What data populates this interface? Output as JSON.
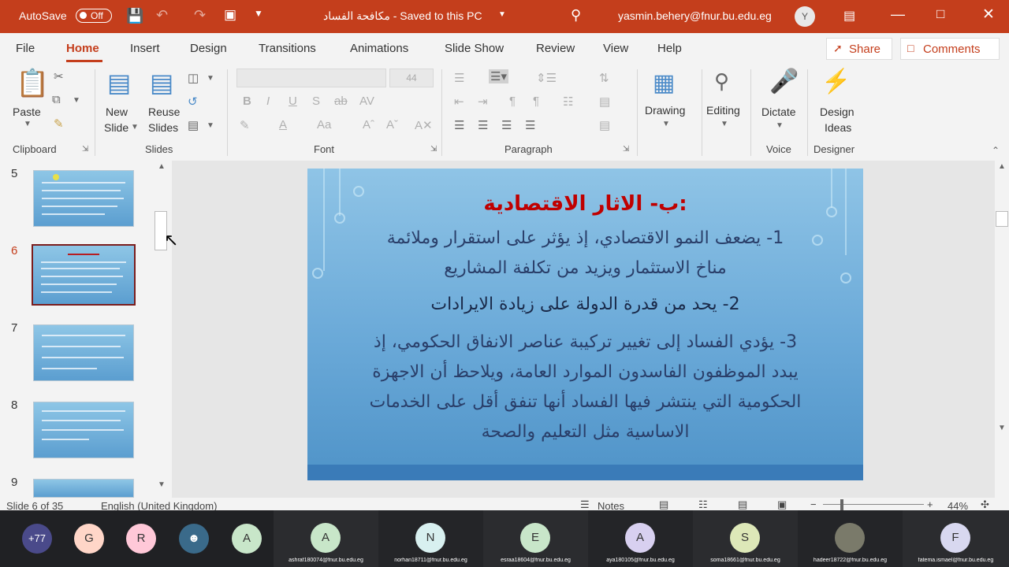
{
  "titlebar": {
    "autosave_label": "AutoSave",
    "autosave_state": "Off",
    "doc_title": "مكافحة الفساد  -  Saved to this PC",
    "user_email": "yasmin.behery@fnur.bu.edu.eg",
    "user_initial": "Y"
  },
  "menu": {
    "items": [
      "File",
      "Home",
      "Insert",
      "Design",
      "Transitions",
      "Animations",
      "Slide Show",
      "Review",
      "View",
      "Help"
    ],
    "share": "Share",
    "comments": "Comments"
  },
  "ribbon": {
    "clipboard": {
      "paste": "Paste",
      "group": "Clipboard"
    },
    "slides": {
      "new_slide_1": "New",
      "new_slide_2": "Slide",
      "reuse_1": "Reuse",
      "reuse_2": "Slides",
      "group": "Slides"
    },
    "font": {
      "group": "Font",
      "size_placeholder": "44"
    },
    "paragraph": {
      "group": "Paragraph"
    },
    "drawing": {
      "label": "Drawing"
    },
    "editing": {
      "label": "Editing"
    },
    "voice": {
      "dictate": "Dictate",
      "group": "Voice"
    },
    "designer": {
      "ideas_1": "Design",
      "ideas_2": "Ideas",
      "group": "Designer"
    }
  },
  "thumbnails": [
    {
      "num": "5"
    },
    {
      "num": "6",
      "selected": true
    },
    {
      "num": "7"
    },
    {
      "num": "8"
    },
    {
      "num": "9"
    }
  ],
  "slide": {
    "title": "ب- الاثار الاقتصادية:",
    "line1": "1- يضعف النمو الاقتصادي، إذ يؤثر على استقرار وملائمة",
    "line2": "مناخ الاستثمار ويزيد من تكلفة المشاريع",
    "line3": "2- يحد من قدرة الدولة على زيادة الايرادات",
    "line4": "3- يؤدي الفساد إلى تغيير تركيبة عناصر الانفاق الحكومي، إذ",
    "line5": "يبدد الموظفون الفاسدون الموارد العامة، ويلاحظ أن الاجهزة",
    "line6": "الحكومية التي ينتشر فيها الفساد أنها تنفق أقل على الخدمات",
    "line7": "الاساسية مثل التعليم والصحة",
    "title_color": "#c00000"
  },
  "status": {
    "slide_info": "Slide 6 of 35",
    "language": "English (United Kingdom)",
    "notes": "Notes",
    "zoom": "44%"
  },
  "meeting": {
    "more_count": "+77",
    "avatars": [
      "G",
      "R",
      "A"
    ],
    "tiles": [
      {
        "initial": "A",
        "email": "ashraf180074@fnur.bu.edu.eg"
      },
      {
        "initial": "N",
        "email": "norhan18711@fnur.bu.edu.eg"
      },
      {
        "initial": "E",
        "email": "esraa18604@fnur.bu.edu.eg"
      },
      {
        "initial": "A",
        "email": "aya180105@fnur.bu.edu.eg"
      },
      {
        "initial": "S",
        "email": "soma18661@fnur.bu.edu.eg"
      },
      {
        "initial": "",
        "email": "hadeer18722@fnur.bu.edu.eg"
      },
      {
        "initial": "F",
        "email": "fatema.ismael@fnur.bu.edu.eg"
      }
    ]
  }
}
